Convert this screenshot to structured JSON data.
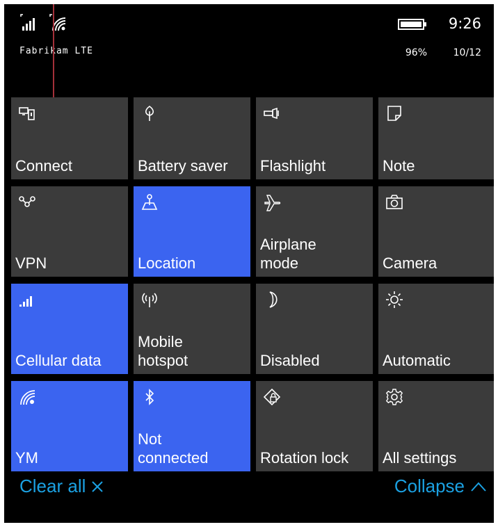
{
  "status_bar": {
    "carrier": "Fabrikam LTE",
    "time": "9:26",
    "battery_percent": "96%",
    "date": "10/12",
    "icons": [
      "signal-strength-icon",
      "wifi-icon",
      "battery-icon"
    ]
  },
  "tiles": [
    {
      "label": "Connect",
      "icon": "connect-icon",
      "active": false
    },
    {
      "label": "Battery saver",
      "icon": "battery-saver-icon",
      "active": false
    },
    {
      "label": "Flashlight",
      "icon": "flashlight-icon",
      "active": false
    },
    {
      "label": "Note",
      "icon": "note-icon",
      "active": false
    },
    {
      "label": "VPN",
      "icon": "vpn-icon",
      "active": false
    },
    {
      "label": "Location",
      "icon": "location-icon",
      "active": true
    },
    {
      "label": "Airplane\nmode",
      "icon": "airplane-icon",
      "active": false
    },
    {
      "label": "Camera",
      "icon": "camera-icon",
      "active": false
    },
    {
      "label": "Cellular data",
      "icon": "cellular-data-icon",
      "active": true
    },
    {
      "label": "Mobile\nhotspot",
      "icon": "mobile-hotspot-icon",
      "active": false
    },
    {
      "label": "Disabled",
      "icon": "moon-icon",
      "active": false
    },
    {
      "label": "Automatic",
      "icon": "brightness-icon",
      "active": false
    },
    {
      "label": "YM",
      "icon": "wifi-icon",
      "active": true
    },
    {
      "label": "Not\nconnected",
      "icon": "bluetooth-icon",
      "active": true
    },
    {
      "label": "Rotation lock",
      "icon": "rotation-lock-icon",
      "active": false
    },
    {
      "label": "All settings",
      "icon": "gear-icon",
      "active": false
    }
  ],
  "footer": {
    "clear_all": "Clear all",
    "collapse": "Collapse"
  },
  "colors": {
    "tile_inactive": "#3b3b3b",
    "tile_active": "#3b64f0",
    "accent_link": "#1ba1e2",
    "background": "#000000"
  }
}
